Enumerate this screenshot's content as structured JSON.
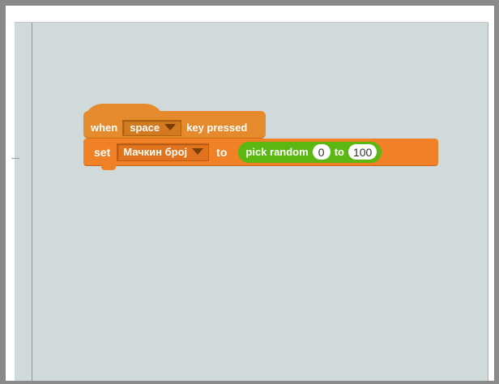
{
  "script": {
    "hat_block": {
      "prefix": "when",
      "key_value": "space",
      "suffix": "key pressed",
      "color": "#e68a2e",
      "icon": "chevron-down-icon"
    },
    "set_block": {
      "prefix": "set",
      "variable": "Мачкин број",
      "to_label": "to",
      "color": "#f08126",
      "icon": "chevron-down-icon"
    },
    "pick_random": {
      "label": "pick random",
      "from": "0",
      "to_label": "to",
      "to": "100",
      "color": "#5cb712"
    }
  }
}
